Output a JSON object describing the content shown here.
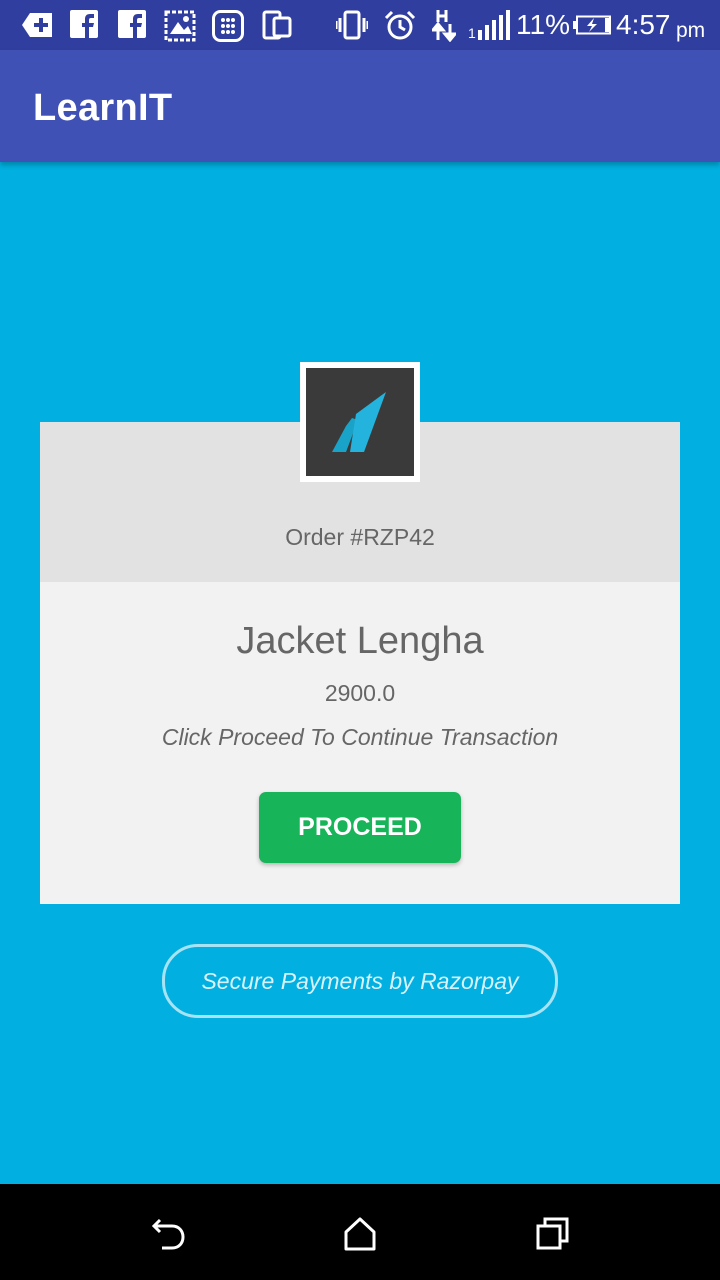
{
  "status_bar": {
    "battery_percent": "11%",
    "time": "4:57",
    "time_suffix": "pm",
    "icons": [
      "add-notification-icon",
      "facebook-icon",
      "facebook-icon",
      "photo-icon",
      "app-grid-icon",
      "tablet-icon",
      "vibrate-icon",
      "alarm-icon",
      "data-transfer-icon",
      "signal-icon",
      "battery-charging-icon"
    ]
  },
  "app_bar": {
    "title": "LearnIT"
  },
  "checkout": {
    "order_label": "Order #RZP42",
    "product_name": "Jacket Lengha",
    "amount": "2900.0",
    "hint": "Click Proceed To Continue Transaction",
    "proceed_label": "PROCEED",
    "secure_label": "Secure Payments by Razorpay"
  },
  "nav_bar": {
    "icons": [
      "back-icon",
      "home-icon",
      "recents-icon"
    ]
  },
  "colors": {
    "status_bar": "#303f9f",
    "app_bar": "#3f51b5",
    "background": "#01b0e0",
    "proceed": "#17b45a"
  }
}
